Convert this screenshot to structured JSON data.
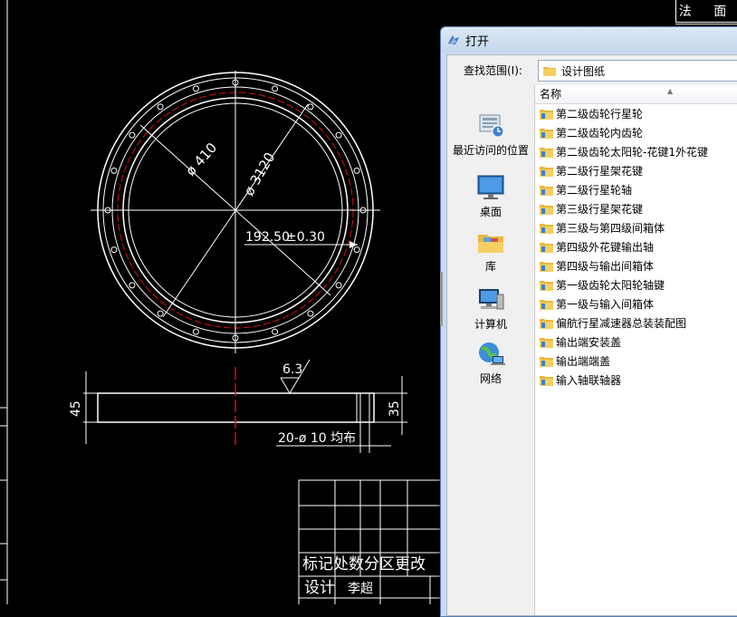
{
  "drawing": {
    "corner_label": "法 面",
    "dim_diameter_inner": "ø 410",
    "dim_diameter_bolt": "ø 3120",
    "dim_radius": "192.50",
    "dim_tolerance": "±0.30",
    "roughness": "6.3",
    "dim_height_left": "45",
    "dim_height_right": "35",
    "holes_note": "20-ø 10 均布",
    "titleblock_header": "标记处数分区更改",
    "titleblock_design_label": "设计",
    "titleblock_designer": "李超"
  },
  "dialog": {
    "title": "打开",
    "look_in_label": "查找范围(I):",
    "look_in_value": "设计图纸",
    "column_name": "名称",
    "places": [
      {
        "label": "最近访问的位置",
        "icon": "recent-places-icon"
      },
      {
        "label": "桌面",
        "icon": "desktop-icon"
      },
      {
        "label": "库",
        "icon": "libraries-icon"
      },
      {
        "label": "计算机",
        "icon": "computer-icon"
      },
      {
        "label": "网络",
        "icon": "network-icon"
      }
    ],
    "files": [
      "第二级齿轮行星轮",
      "第二级齿轮内齿轮",
      "第二级齿轮太阳轮-花键1外花键",
      "第二级行星架花键",
      "第二级行星轮轴",
      "第三级行星架花键",
      "第三级与第四级间箱体",
      "第四级外花键输出轴",
      "第四级与输出间箱体",
      "第一级齿轮太阳轮轴键",
      "第一级与输入间箱体",
      "偏航行星减速器总装装配图",
      "输出端安装盖",
      "输出端端盖",
      "输入轴联轴器"
    ]
  },
  "colors": {
    "cad_background": "#000000",
    "cad_line": "#ffffff",
    "center_line": "#d01010",
    "folder": "#e8b840",
    "dialog_frame": "#c9dcef"
  }
}
